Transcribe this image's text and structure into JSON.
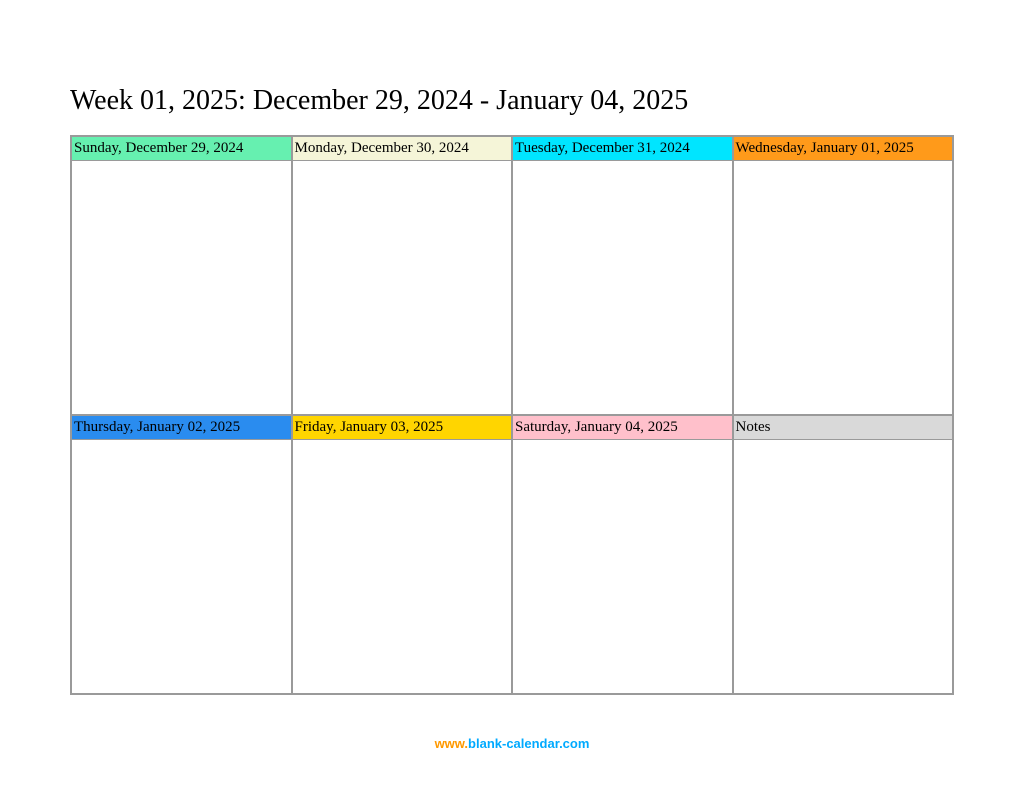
{
  "title": "Week 01, 2025: December 29, 2024 - January 04, 2025",
  "cells": [
    {
      "label": "Sunday, December 29, 2024",
      "color": "#66f0b0"
    },
    {
      "label": "Monday, December 30, 2024",
      "color": "#f5f5d8"
    },
    {
      "label": "Tuesday, December 31, 2024",
      "color": "#00e5ff"
    },
    {
      "label": "Wednesday, January 01, 2025",
      "color": "#ff9a1a"
    },
    {
      "label": "Thursday, January 02, 2025",
      "color": "#2a8cef"
    },
    {
      "label": "Friday, January 03, 2025",
      "color": "#ffd500"
    },
    {
      "label": "Saturday, January 04, 2025",
      "color": "#ffc0cb"
    },
    {
      "label": "Notes",
      "color": "#d9d9d9"
    }
  ],
  "footer": {
    "part1": "www.",
    "part2": "blank-calendar.com"
  }
}
